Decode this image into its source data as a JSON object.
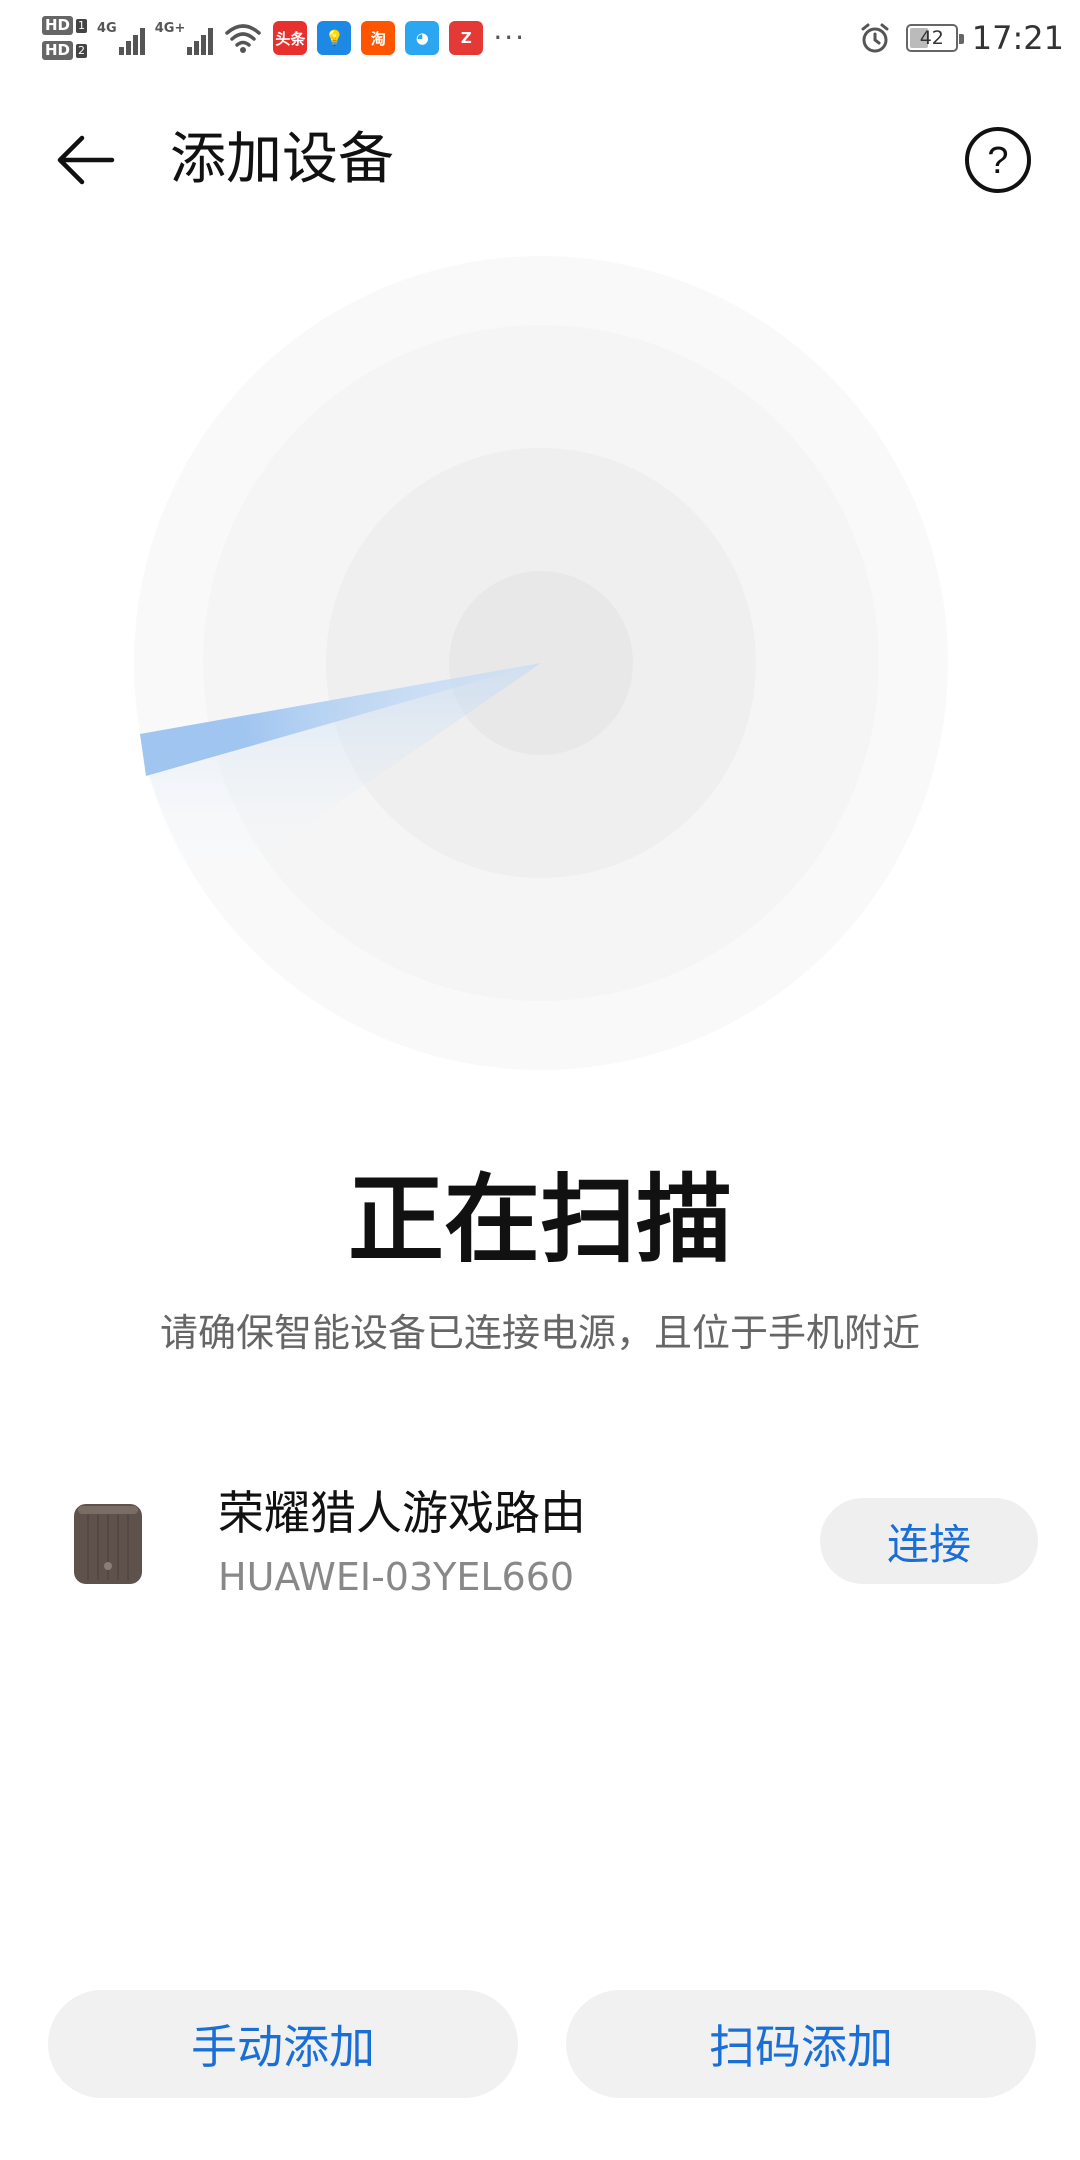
{
  "status_bar": {
    "hd1": "HD",
    "hd1_sim": "1",
    "hd2": "HD",
    "hd2_sim": "2",
    "net1": "4G",
    "net2": "4G+",
    "app_icons": [
      {
        "name": "toutiao-icon",
        "label": "头条",
        "color": "#e8312f"
      },
      {
        "name": "bulb-icon",
        "label": "💡",
        "color": "#1e88e5"
      },
      {
        "name": "taobao-icon",
        "label": "淘",
        "color": "#ff5500"
      },
      {
        "name": "qq-icon",
        "label": "◕",
        "color": "#2aa7f0"
      },
      {
        "name": "app-icon",
        "label": "Z",
        "color": "#e53935"
      }
    ],
    "more_dots": "···",
    "battery_level": "42",
    "battery_fraction": 0.42,
    "time": "17:21"
  },
  "title_bar": {
    "title": "添加设备"
  },
  "scan": {
    "title": "正在扫描",
    "subtitle": "请确保智能设备已连接电源，且位于手机附近"
  },
  "device": {
    "name": "荣耀猎人游戏路由",
    "id": "HUAWEI-03YEL660",
    "connect_label": "连接"
  },
  "buttons": {
    "manual": "手动添加",
    "scan_code": "扫码添加"
  },
  "colors": {
    "accent": "#1a6fd6",
    "button_bg": "#f1f1f1",
    "radar_beam": "#9cc3f0"
  }
}
